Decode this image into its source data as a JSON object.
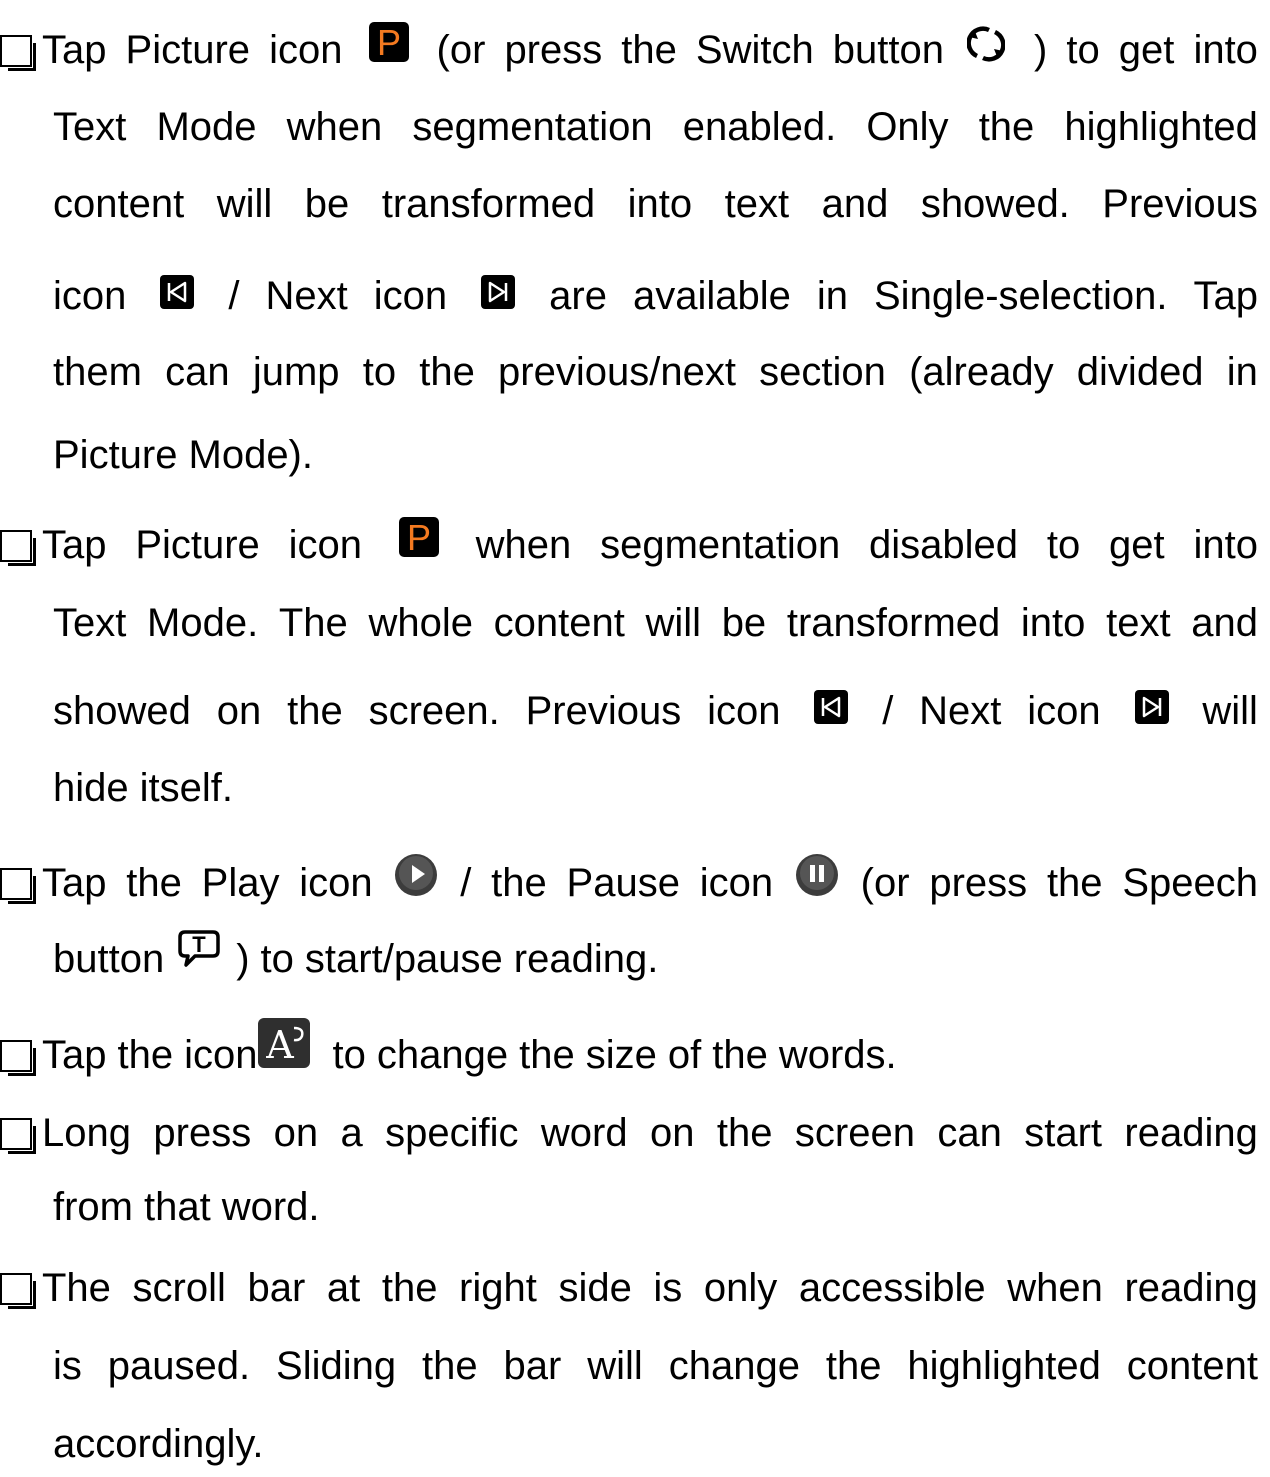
{
  "items": [
    {
      "lines": [
        [
          "Tap",
          "Picture",
          "icon",
          "{P}",
          "(or",
          "press",
          "the",
          "Switch",
          "button",
          "{SW}",
          ")",
          "to",
          "get",
          "into"
        ],
        [
          "Text",
          "Mode",
          "when",
          "segmentation",
          "enabled.",
          "Only",
          "the",
          "highlighted"
        ],
        [
          "content",
          "will",
          "be",
          "transformed",
          "into",
          "text",
          "and",
          "showed.",
          "Previous"
        ],
        [
          "icon",
          "{PREV}",
          "/",
          "Next",
          "icon",
          "{NEXT}",
          "are",
          "available",
          "in",
          "Single-selection.",
          "Tap"
        ],
        [
          "them",
          "can",
          "jump",
          "to",
          "the",
          "previous/next",
          "section",
          "(already",
          "divided",
          "in"
        ],
        [
          "Picture",
          "Mode)."
        ]
      ]
    },
    {
      "lines": [
        [
          "Tap",
          "Picture",
          "icon",
          "{P}",
          "when",
          "segmentation",
          "disabled",
          "to",
          "get",
          "into"
        ],
        [
          "Text",
          "Mode.",
          "The",
          "whole",
          "content",
          "will",
          "be",
          "transformed",
          "into",
          "text",
          "and"
        ],
        [
          "showed",
          "on",
          "the",
          "screen.",
          "Previous",
          "icon",
          "{PREV}",
          "/",
          "Next",
          "icon",
          "{NEXT}",
          "will"
        ],
        [
          "hide",
          "itself."
        ]
      ]
    },
    {
      "lines": [
        [
          "Tap",
          "the",
          "Play",
          "icon",
          "{PLAY}",
          "/",
          "the",
          "Pause",
          "icon",
          "{PAUSE}",
          "(or",
          "press",
          "the",
          "Speech"
        ],
        [
          "button",
          "{SPEECH}",
          ")",
          "to",
          "start/pause",
          "reading."
        ]
      ]
    },
    {
      "lines": [
        [
          "Tap",
          "the",
          "icon{FONT}",
          "to",
          "change",
          "the",
          "size",
          "of",
          "the",
          "words."
        ]
      ]
    },
    {
      "lines": [
        [
          "Long",
          "press",
          "on",
          "a",
          "specific",
          "word",
          "on",
          "the",
          "screen",
          "can",
          "start",
          "reading"
        ],
        [
          "from",
          "that",
          "word."
        ]
      ]
    },
    {
      "lines": [
        [
          "The",
          "scroll",
          "bar",
          "at",
          "the",
          "right",
          "side",
          "is",
          "only",
          "accessible",
          "when",
          "reading"
        ],
        [
          "is",
          "paused.",
          "Sliding",
          "the",
          "bar",
          "will",
          "change",
          "the",
          "highlighted",
          "content"
        ],
        [
          "accordingly."
        ]
      ]
    }
  ],
  "icons": {
    "P": {
      "name": "picture-icon",
      "letter": "P",
      "color": "#f47a20"
    },
    "SW": {
      "name": "switch-button-icon"
    },
    "PREV": {
      "name": "previous-icon"
    },
    "NEXT": {
      "name": "next-icon"
    },
    "PLAY": {
      "name": "play-icon"
    },
    "PAUSE": {
      "name": "pause-icon"
    },
    "SPEECH": {
      "name": "speech-button-icon",
      "letter": "T"
    },
    "FONT": {
      "name": "font-size-icon",
      "letter": "A"
    }
  }
}
